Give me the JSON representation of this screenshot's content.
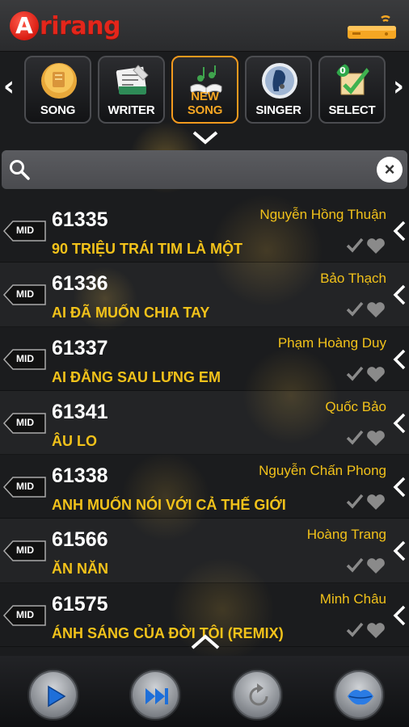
{
  "header": {
    "logo_letter": "A",
    "logo_text": "rirang"
  },
  "categories": [
    {
      "label": "SONG",
      "icon": "song-icon"
    },
    {
      "label": "WRITER",
      "icon": "writer-icon"
    },
    {
      "label": "NEW SONG",
      "icon": "new-song-icon",
      "active": true
    },
    {
      "label": "SINGER",
      "icon": "singer-icon"
    },
    {
      "label": "SELECT",
      "icon": "select-icon",
      "badge": "0"
    }
  ],
  "search": {
    "value": "",
    "placeholder": ""
  },
  "songs": [
    {
      "tag": "MID",
      "code": "61335",
      "title": "90 TRIỆU TRÁI TIM LÀ MỘT",
      "singer": "Nguyễn Hồng Thuận"
    },
    {
      "tag": "MID",
      "code": "61336",
      "title": "AI ĐÃ MUỐN CHIA TAY",
      "singer": "Bảo Thạch"
    },
    {
      "tag": "MID",
      "code": "61337",
      "title": "AI ĐẰNG SAU LƯNG EM",
      "singer": "Phạm Hoàng Duy"
    },
    {
      "tag": "MID",
      "code": "61341",
      "title": "ÂU LO",
      "singer": "Quốc Bảo"
    },
    {
      "tag": "MID",
      "code": "61338",
      "title": "ANH MUỐN NÓI VỚI CẢ THẾ GIỚI",
      "singer": "Nguyễn Chấn Phong"
    },
    {
      "tag": "MID",
      "code": "61566",
      "title": "ĂN NĂN",
      "singer": "Hoàng Trang"
    },
    {
      "tag": "MID",
      "code": "61575",
      "title": "ÁNH SÁNG CỦA ĐỜI TÔI (REMIX)",
      "singer": "Minh Châu"
    }
  ],
  "colors": {
    "accent": "#f5a623",
    "title": "#f2c21a",
    "logo": "#e3261b"
  }
}
